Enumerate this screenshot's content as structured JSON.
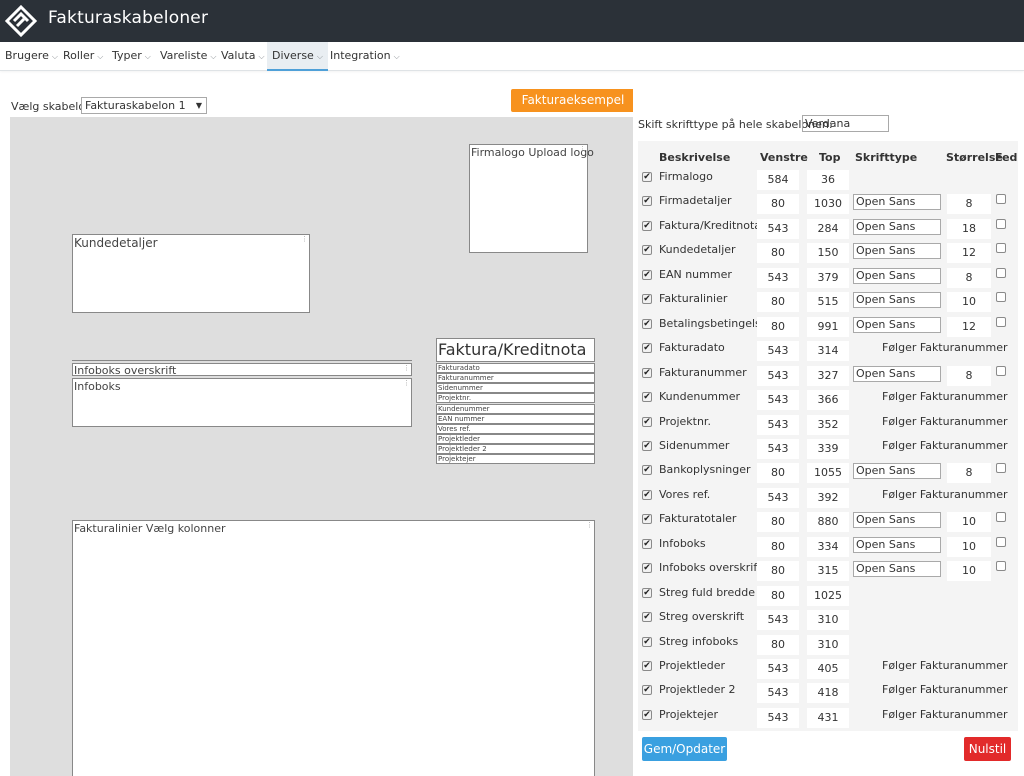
{
  "header": {
    "title": "Fakturaskabeloner"
  },
  "nav": [
    {
      "label": "Brugere",
      "active": false
    },
    {
      "label": "Roller",
      "active": false
    },
    {
      "label": "Typer",
      "active": false
    },
    {
      "label": "Vareliste",
      "active": false
    },
    {
      "label": "Valuta",
      "active": false
    },
    {
      "label": "Diverse",
      "active": true
    },
    {
      "label": "Integration",
      "active": false
    }
  ],
  "template": {
    "label": "Vælg skabelon",
    "selected": "Fakturaskabelon 1"
  },
  "pdf_button": "Fakturaeksempel pdf",
  "font_setting": {
    "label": "Skift skrifttype på hele skabelonen:",
    "value": "Verdana"
  },
  "canvas": {
    "firmalogo": "Firmalogo Upload logo",
    "kundedetaljer": "Kundedetaljer",
    "infoboks_overskrift": "Infoboks overskrift",
    "infoboks": "Infoboks",
    "fakturalinier": "Fakturalinier Vælg kolonner",
    "faktura_title": "Faktura/Kreditnota",
    "faktura_rows": [
      "Fakturadato",
      "Fakturanummer",
      "Sidenummer",
      "Projektnr.",
      "Kundenummer",
      "EAN nummer",
      "Vores ref.",
      "Projektleder",
      "Projektleder 2",
      "Projektejer"
    ]
  },
  "table": {
    "headers": {
      "beskrivelse": "Beskrivelse",
      "venstre": "Venstre",
      "top": "Top",
      "skrifttype": "Skrifttype",
      "storrelse": "Størrelse",
      "fed": "Fed"
    },
    "rows": [
      {
        "name": "Firmalogo",
        "left": "584",
        "top": "36",
        "font": "",
        "size": "",
        "follows": ""
      },
      {
        "name": "Firmadetaljer",
        "left": "80",
        "top": "1030",
        "font": "Open Sans",
        "size": "8",
        "follows": ""
      },
      {
        "name": "Faktura/Kreditnota",
        "left": "543",
        "top": "284",
        "font": "Open Sans",
        "size": "18",
        "follows": ""
      },
      {
        "name": "Kundedetaljer",
        "left": "80",
        "top": "150",
        "font": "Open Sans",
        "size": "12",
        "follows": ""
      },
      {
        "name": "EAN nummer",
        "left": "543",
        "top": "379",
        "font": "Open Sans",
        "size": "8",
        "follows": ""
      },
      {
        "name": "Fakturalinier",
        "left": "80",
        "top": "515",
        "font": "Open Sans",
        "size": "10",
        "follows": ""
      },
      {
        "name": "Betalingsbetingelser",
        "left": "80",
        "top": "991",
        "font": "Open Sans",
        "size": "12",
        "follows": ""
      },
      {
        "name": "Fakturadato",
        "left": "543",
        "top": "314",
        "font": "",
        "size": "",
        "follows": "Følger Fakturanummer"
      },
      {
        "name": "Fakturanummer",
        "left": "543",
        "top": "327",
        "font": "Open Sans",
        "size": "8",
        "follows": ""
      },
      {
        "name": "Kundenummer",
        "left": "543",
        "top": "366",
        "font": "",
        "size": "",
        "follows": "Følger Fakturanummer"
      },
      {
        "name": "Projektnr.",
        "left": "543",
        "top": "352",
        "font": "",
        "size": "",
        "follows": "Følger Fakturanummer"
      },
      {
        "name": "Sidenummer",
        "left": "543",
        "top": "339",
        "font": "",
        "size": "",
        "follows": "Følger Fakturanummer"
      },
      {
        "name": "Bankoplysninger",
        "left": "80",
        "top": "1055",
        "font": "Open Sans",
        "size": "8",
        "follows": ""
      },
      {
        "name": "Vores ref.",
        "left": "543",
        "top": "392",
        "font": "",
        "size": "",
        "follows": "Følger Fakturanummer"
      },
      {
        "name": "Fakturatotaler",
        "left": "80",
        "top": "880",
        "font": "Open Sans",
        "size": "10",
        "follows": ""
      },
      {
        "name": "Infoboks",
        "left": "80",
        "top": "334",
        "font": "Open Sans",
        "size": "10",
        "follows": ""
      },
      {
        "name": "Infoboks overskrift",
        "left": "80",
        "top": "315",
        "font": "Open Sans",
        "size": "10",
        "follows": ""
      },
      {
        "name": "Streg fuld bredde",
        "left": "80",
        "top": "1025",
        "font": "",
        "size": "",
        "follows": ""
      },
      {
        "name": "Streg overskrift",
        "left": "543",
        "top": "310",
        "font": "",
        "size": "",
        "follows": ""
      },
      {
        "name": "Streg infoboks",
        "left": "80",
        "top": "310",
        "font": "",
        "size": "",
        "follows": ""
      },
      {
        "name": "Projektleder",
        "left": "543",
        "top": "405",
        "font": "",
        "size": "",
        "follows": "Følger Fakturanummer"
      },
      {
        "name": "Projektleder 2",
        "left": "543",
        "top": "418",
        "font": "",
        "size": "",
        "follows": "Følger Fakturanummer"
      },
      {
        "name": "Projektejer",
        "left": "543",
        "top": "431",
        "font": "",
        "size": "",
        "follows": "Følger Fakturanummer"
      }
    ]
  },
  "buttons": {
    "save": "Gem/Opdater",
    "reset": "Nulstil"
  }
}
